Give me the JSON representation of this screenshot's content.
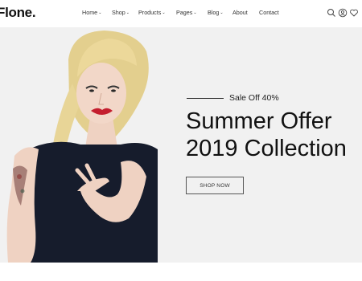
{
  "brand": {
    "logo": "Flone."
  },
  "nav": {
    "items": [
      {
        "label": "Home",
        "has_dropdown": true
      },
      {
        "label": "Shop",
        "has_dropdown": true
      },
      {
        "label": "Products",
        "has_dropdown": true
      },
      {
        "label": "Pages",
        "has_dropdown": true
      },
      {
        "label": "Blog",
        "has_dropdown": true
      },
      {
        "label": "About",
        "has_dropdown": false
      },
      {
        "label": "Contact",
        "has_dropdown": false
      }
    ]
  },
  "header_icons": [
    "search-icon",
    "user-icon",
    "heart-icon",
    "cart-icon"
  ],
  "hero": {
    "sale_text": "Sale Off 40%",
    "title_line1": "Summer Offer",
    "title_line2": "2019 Collection",
    "button_label": "SHOP NOW",
    "background_color": "#f1f1f1"
  }
}
